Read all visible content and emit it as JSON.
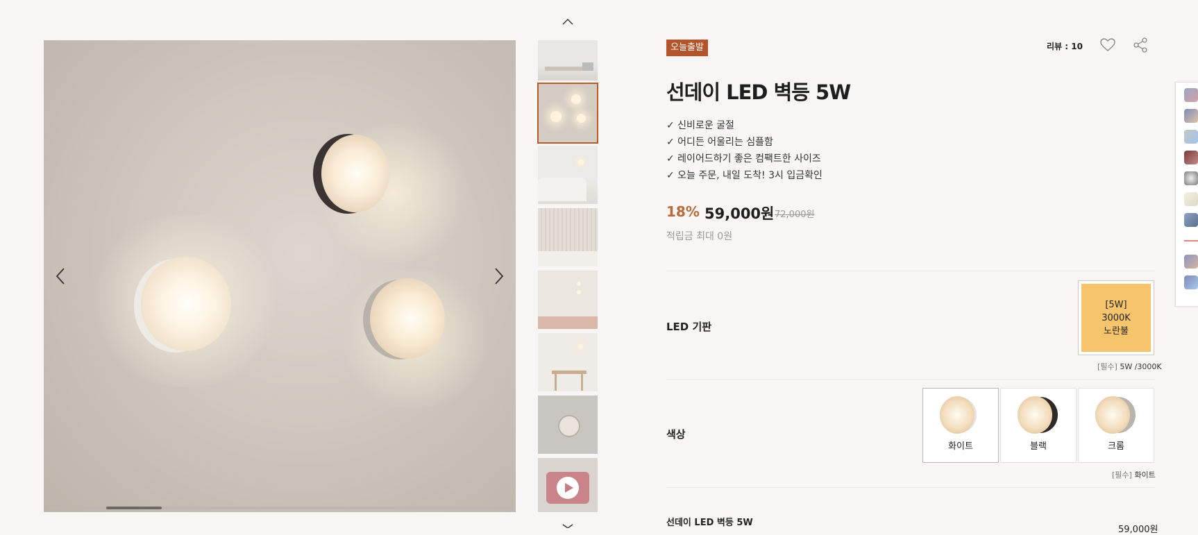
{
  "badge": "오늘출발",
  "review_count": "리뷰 : 10",
  "product_title": "선데이 LED 벽등 5W",
  "features": [
    "✓ 신비로운 굴절",
    "✓ 어디든 어울리는 심플함",
    "✓ 레이어드하기 좋은 컴팩트한 사이즈",
    "✓ 오늘 주문, 내일 도착! 3시 입금확인"
  ],
  "price": {
    "discount": "18%",
    "sale": "59,000원",
    "original": "72,000원",
    "points": "적립금 최대 0원"
  },
  "options": {
    "led": {
      "label": "LED 기판",
      "choice": "[5W]\n3000K\n노란불",
      "hint_req": "[필수]",
      "hint_value": "5W /3000K"
    },
    "color": {
      "label": "색상",
      "choices": [
        "화이트",
        "블랙",
        "크롬"
      ],
      "hint_req": "[필수]",
      "hint_value": "화이트"
    }
  },
  "selected_item": {
    "name": "선데이 LED 벽등 5W",
    "price": "59,000원"
  },
  "colors": {
    "accent": "#b4542a",
    "discount": "#b86a3c",
    "led_option_bg": "#f6c46a"
  },
  "icons": [
    "chevron-up-icon",
    "chevron-down-icon",
    "chevron-left-icon",
    "chevron-right-icon",
    "heart-icon",
    "share-icon",
    "play-icon"
  ]
}
